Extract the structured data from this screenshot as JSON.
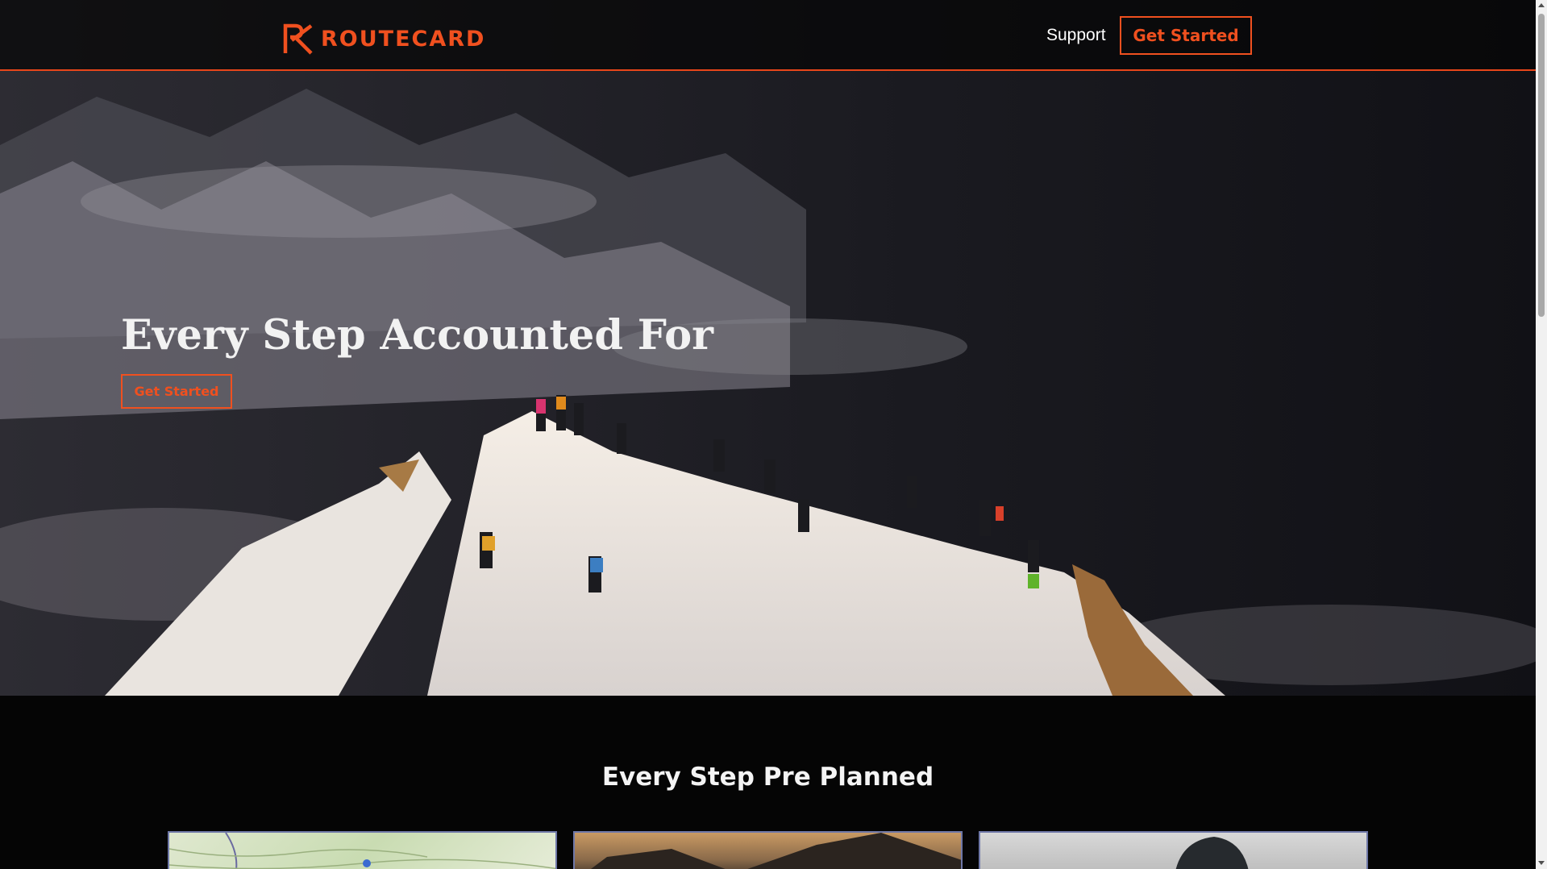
{
  "brand": {
    "name": "ROUTECARD",
    "accent": "#f0501f"
  },
  "nav": {
    "support_label": "Support",
    "cta_label": "Get Started"
  },
  "hero": {
    "title": "Every Step Accounted For",
    "cta_label": "Get Started",
    "image": "mountain-ridge-climbers-photo"
  },
  "section": {
    "title": "Every Step Pre Planned",
    "cards": [
      {
        "image": "topographic-map-thumbnail"
      },
      {
        "image": "mountain-sunset-thumbnail"
      },
      {
        "image": "hooded-person-thumbnail"
      }
    ]
  }
}
